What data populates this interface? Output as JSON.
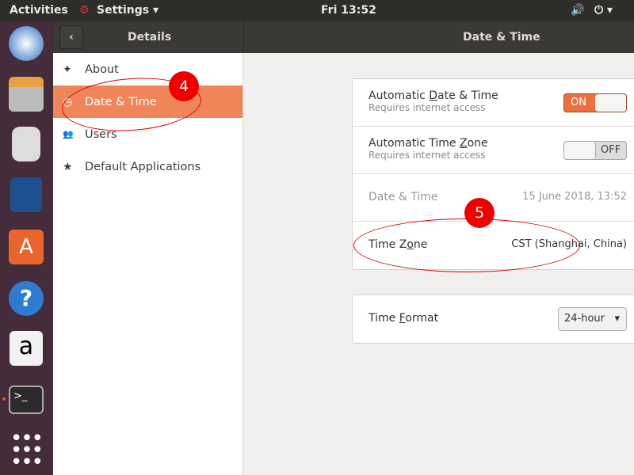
{
  "topbar": {
    "activities": "Activities",
    "app": "Settings",
    "clock": "Fri 13:52"
  },
  "header": {
    "left_title": "Details",
    "right_title": "Date & Time"
  },
  "sidebar": {
    "items": [
      {
        "label": "About",
        "icon": "✦"
      },
      {
        "label": "Date & Time",
        "icon": "◷"
      },
      {
        "label": "Users",
        "icon": "👥"
      },
      {
        "label": "Default Applications",
        "icon": "★"
      }
    ]
  },
  "settings": {
    "auto_dt": {
      "pre": "Automatic ",
      "u": "D",
      "post": "ate & Time",
      "sub": "Requires internet access",
      "state": "ON"
    },
    "auto_tz": {
      "pre": "Automatic Time ",
      "u": "Z",
      "post": "one",
      "sub": "Requires internet access",
      "state": "OFF"
    },
    "date_time": {
      "label": "Date & Time",
      "value": "15 June 2018, 13:52"
    },
    "time_zone": {
      "pre": "Time Z",
      "u": "o",
      "post": "ne",
      "value": "CST (Shanghai, China)"
    },
    "time_format": {
      "pre": "Time ",
      "u": "F",
      "post": "ormat",
      "value": "24-hour"
    }
  },
  "annotations": {
    "a4": "4",
    "a5": "5"
  },
  "colors": {
    "accent": "#f0855a",
    "dock": "#452c3a"
  }
}
